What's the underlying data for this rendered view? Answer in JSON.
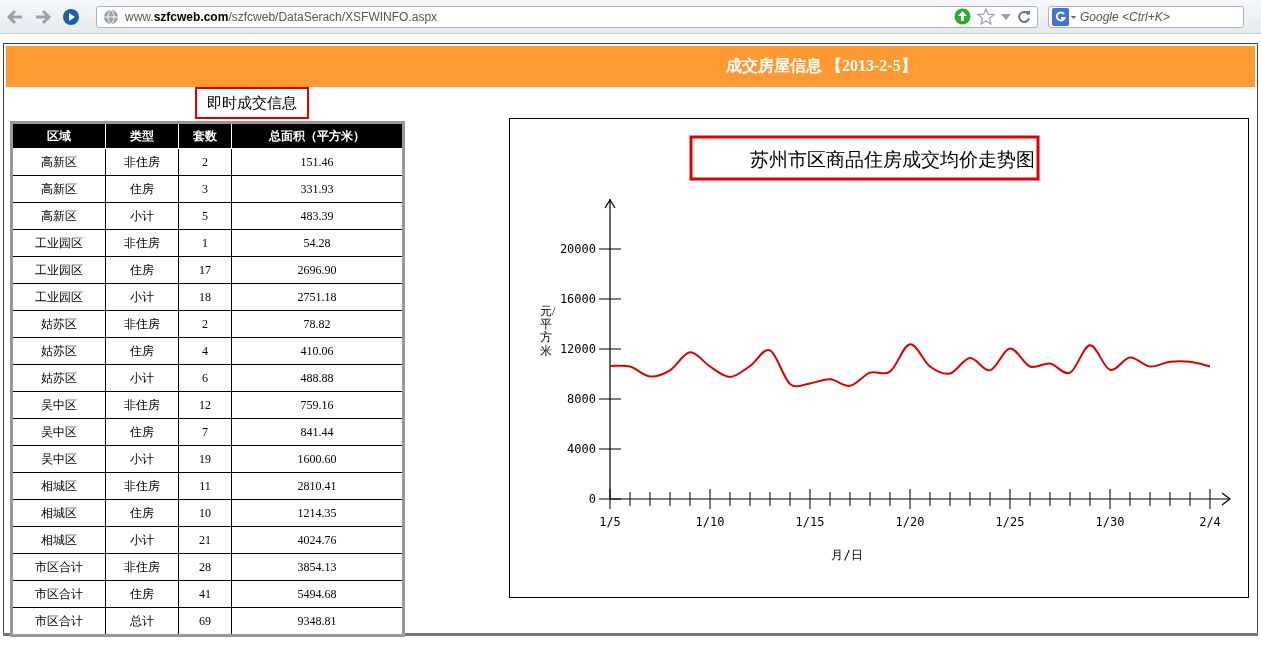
{
  "browser": {
    "url": "www.**szfcweb.com**/szfcweb/DataSerach/XSFWINFO.aspx",
    "search": {
      "placeholder": "Google <Ctrl+K>"
    }
  },
  "header": {
    "title": "成交房屋信息 【2013-2-5】"
  },
  "section_label": "即时成交信息",
  "table": {
    "columns": [
      "区域",
      "类型",
      "套数",
      "总面积（平方米）"
    ],
    "rows": [
      [
        "高新区",
        "非住房",
        "2",
        "151.46"
      ],
      [
        "高新区",
        "住房",
        "3",
        "331.93"
      ],
      [
        "高新区",
        "小计",
        "5",
        "483.39"
      ],
      [
        "工业园区",
        "非住房",
        "1",
        "54.28"
      ],
      [
        "工业园区",
        "住房",
        "17",
        "2696.90"
      ],
      [
        "工业园区",
        "小计",
        "18",
        "2751.18"
      ],
      [
        "姑苏区",
        "非住房",
        "2",
        "78.82"
      ],
      [
        "姑苏区",
        "住房",
        "4",
        "410.06"
      ],
      [
        "姑苏区",
        "小计",
        "6",
        "488.88"
      ],
      [
        "吴中区",
        "非住房",
        "12",
        "759.16"
      ],
      [
        "吴中区",
        "住房",
        "7",
        "841.44"
      ],
      [
        "吴中区",
        "小计",
        "19",
        "1600.60"
      ],
      [
        "相城区",
        "非住房",
        "11",
        "2810.41"
      ],
      [
        "相城区",
        "住房",
        "10",
        "1214.35"
      ],
      [
        "相城区",
        "小计",
        "21",
        "4024.76"
      ],
      [
        "市区合计",
        "非住房",
        "28",
        "3854.13"
      ],
      [
        "市区合计",
        "住房",
        "41",
        "5494.68"
      ],
      [
        "市区合计",
        "总计",
        "69",
        "9348.81"
      ]
    ]
  },
  "chart": {
    "chart_data": {
      "type": "line",
      "title": "苏州市区商品住房成交均价走势图",
      "xlabel": "月/日",
      "ylabel": "元/平方米",
      "categories": [
        "1/5",
        null,
        null,
        null,
        null,
        "1/10",
        null,
        null,
        null,
        null,
        "1/15",
        null,
        null,
        null,
        null,
        "1/20",
        null,
        null,
        null,
        null,
        "1/25",
        null,
        null,
        null,
        null,
        "1/30",
        null,
        null,
        null,
        null,
        "2/4"
      ],
      "series": [
        {
          "color": "#dd0000",
          "values": [
            10640,
            10600,
            9800,
            10300,
            11740,
            10600,
            9770,
            10640,
            11890,
            9210,
            9250,
            9580,
            9060,
            10110,
            10190,
            12380,
            10600,
            10040,
            11280,
            10300,
            12040,
            10600,
            10830,
            10110,
            12300,
            10340,
            11320,
            10600,
            10980,
            10980,
            10600
          ]
        }
      ],
      "ylim": [
        0,
        24000
      ],
      "yticks": [
        0,
        4000,
        8000,
        12000,
        16000,
        20000
      ]
    }
  }
}
